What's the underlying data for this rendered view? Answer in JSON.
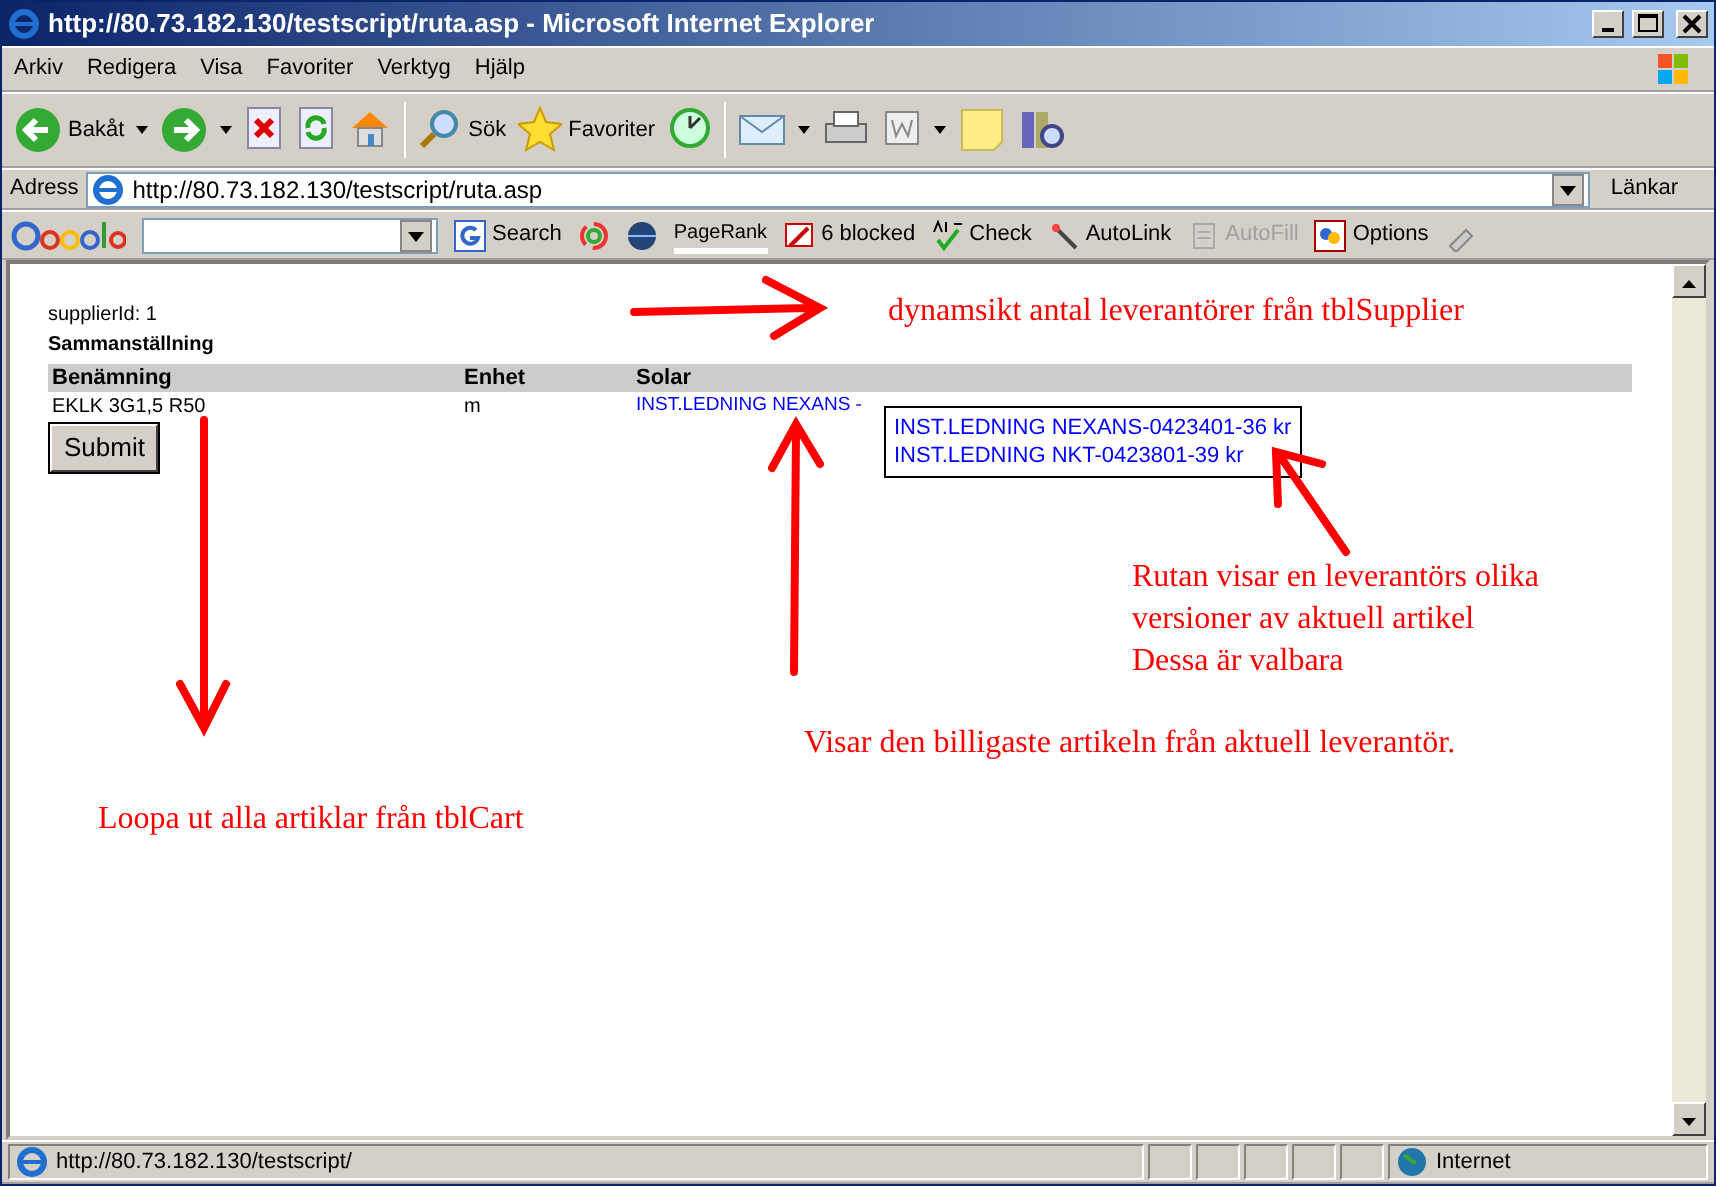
{
  "window": {
    "title": "http://80.73.182.130/testscript/ruta.asp - Microsoft Internet Explorer"
  },
  "menu": [
    "Arkiv",
    "Redigera",
    "Visa",
    "Favoriter",
    "Verktyg",
    "Hjälp"
  ],
  "toolbar": [
    {
      "kind": "back",
      "label": "Bakåt"
    },
    {
      "kind": "forward"
    },
    {
      "kind": "stop"
    },
    {
      "kind": "refresh"
    },
    {
      "kind": "home"
    },
    {
      "kind": "search",
      "label": "Sök"
    },
    {
      "kind": "favorites",
      "label": "Favoriter"
    },
    {
      "kind": "history"
    },
    {
      "kind": "mail"
    },
    {
      "kind": "print"
    },
    {
      "kind": "word"
    },
    {
      "kind": "note"
    },
    {
      "kind": "research"
    }
  ],
  "address_bar": {
    "label": "Adress",
    "value": "http://80.73.182.130/testscript/ruta.asp",
    "links": "Länkar"
  },
  "google_bar": {
    "search": "Search",
    "pagerank": "PageRank",
    "blocked": "6 blocked",
    "check": "Check",
    "autolink": "AutoLink",
    "autofill": "AutoFill",
    "options": "Options"
  },
  "page": {
    "supplier_line": "supplierId: 1",
    "heading": "Sammanställning",
    "columns": [
      "Benämning",
      "Enhet",
      "Solar"
    ],
    "rows": [
      {
        "name": "EKLK 3G1,5 R50",
        "unit": "m",
        "choice": "INST.LEDNING NEXANS -"
      }
    ],
    "options": [
      "INST.LEDNING NEXANS-0423401-36 kr",
      "INST.LEDNING NKT-0423801-39 kr"
    ],
    "submit": "Submit"
  },
  "annotations": [
    "dynamsikt antal leverantörer från tblSupplier",
    "Loopa ut alla artiklar från tblCart",
    "Visar den billigaste artikeln från aktuell leverantör.",
    "Rutan visar en leverantörs olika\nversioner av aktuell artikel\nDessa är valbara"
  ],
  "status_bar": {
    "url": "http://80.73.182.130/testscript/",
    "zone": "Internet"
  }
}
